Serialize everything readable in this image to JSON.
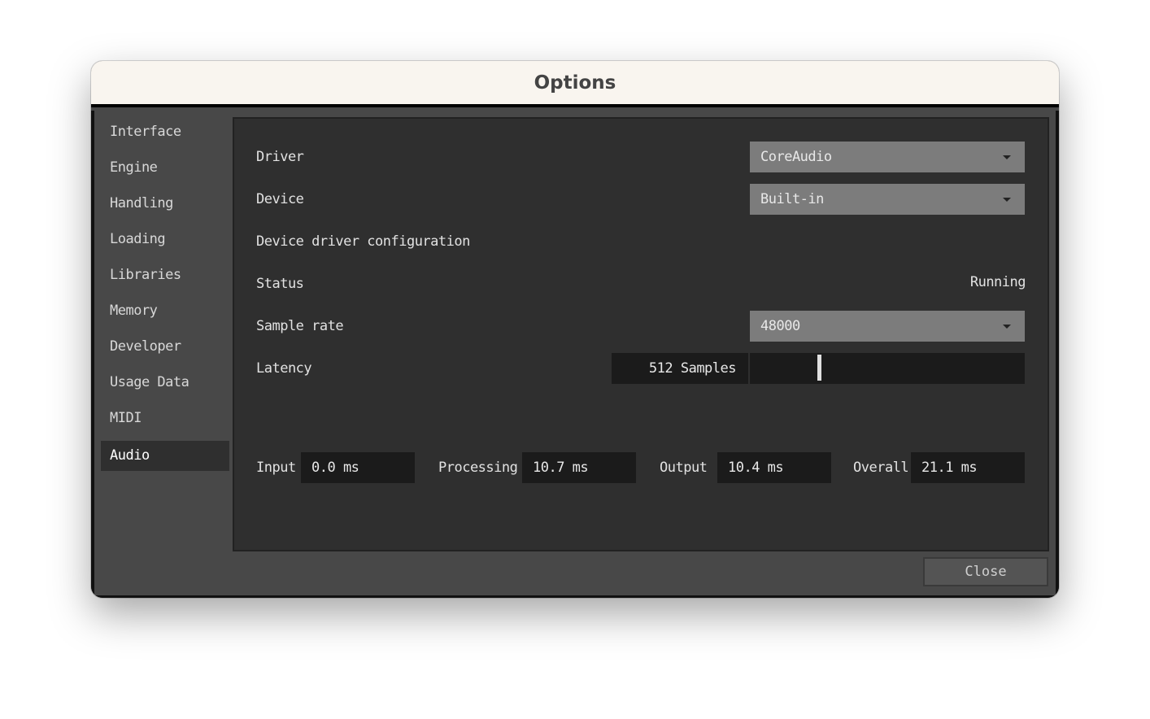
{
  "window": {
    "title": "Options"
  },
  "sidebar": {
    "items": [
      {
        "label": "Interface"
      },
      {
        "label": "Engine"
      },
      {
        "label": "Handling"
      },
      {
        "label": "Loading"
      },
      {
        "label": "Libraries"
      },
      {
        "label": "Memory"
      },
      {
        "label": "Developer"
      },
      {
        "label": "Usage Data"
      },
      {
        "label": "MIDI"
      },
      {
        "label": "Audio",
        "active": true
      }
    ]
  },
  "audio": {
    "driver_label": "Driver",
    "driver_value": "CoreAudio",
    "device_label": "Device",
    "device_value": "Built-in",
    "config_label": "Device driver configuration",
    "status_label": "Status",
    "status_value": "Running",
    "rate_label": "Sample rate",
    "rate_value": "48000",
    "latency_label": "Latency",
    "latency_value": "512 Samples",
    "latency_slider_fraction": 0.25,
    "input_label": "Input",
    "input_value": "0.0 ms",
    "processing_label": "Processing",
    "processing_value": "10.7 ms",
    "output_label": "Output",
    "output_value": "10.4 ms",
    "overall_label": "Overall",
    "overall_value": "21.1 ms"
  },
  "footer": {
    "close_label": "Close"
  }
}
